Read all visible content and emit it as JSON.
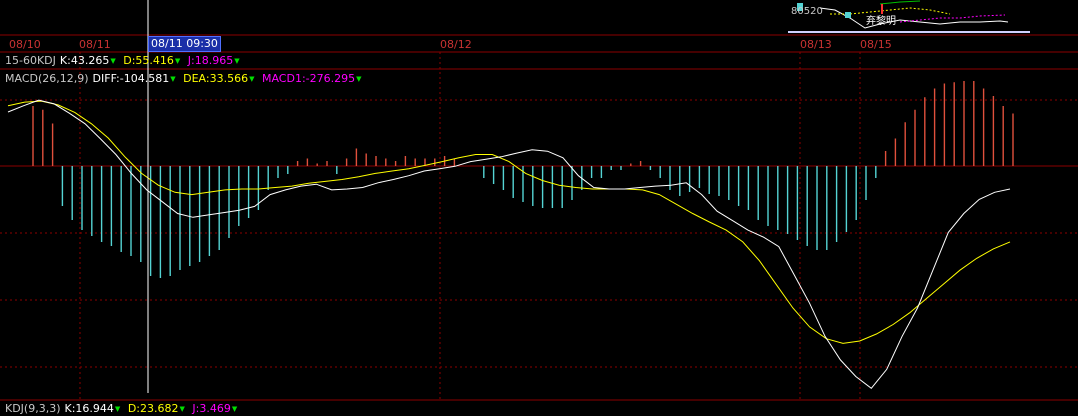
{
  "date_axis": {
    "labels": [
      "08/10",
      "08/11",
      "08/12",
      "08/13",
      "08/15"
    ],
    "cursor_label": "08/11 09:30"
  },
  "kdj_15_60": {
    "name": "15-60KDJ",
    "k": "K:43.265",
    "d": "D:55.416",
    "j": "J:18.965"
  },
  "macd": {
    "name": "MACD(26,12,9)",
    "diff": "DIFF:-104.581",
    "dea": "DEA:33.566",
    "macd1": "MACD1:-276.295"
  },
  "kdj_bottom": {
    "name": "KDJ(9,3,3)",
    "k": "K:16.944",
    "d": "D:23.682",
    "j": "J:3.469"
  },
  "mini_panel": {
    "value_text": "80520",
    "tag_text": "弃黎明"
  },
  "colors": {
    "background": "#000000",
    "grid": "#8b0000",
    "positive_bar": "#e0503c",
    "negative_bar": "#54d4d4",
    "diff_line": "#ffffff",
    "dea_line": "#ffff00",
    "k_color": "#ffffff",
    "d_color": "#ffff00",
    "j_color": "#ff00ff",
    "date_label": "#c83232"
  },
  "chart_data": {
    "type": "line",
    "title": "MACD(26,12,9)",
    "histogram": [
      48,
      45,
      34,
      -20,
      -27,
      -32,
      -35,
      -38,
      -40,
      -43,
      -45,
      -48,
      -55,
      -56,
      -55,
      -52,
      -50,
      -48,
      -45,
      -42,
      -36,
      -30,
      -26,
      -22,
      -12,
      -6,
      -4,
      4,
      6,
      2,
      4,
      -4,
      6,
      14,
      10,
      8,
      6,
      4,
      8,
      6,
      6,
      6,
      8,
      6,
      0,
      0,
      -6,
      -9,
      -12,
      -16,
      -18,
      -20,
      -21,
      -21,
      -21,
      -17,
      -12,
      -6,
      -6,
      -2,
      -2,
      2,
      4,
      -2,
      -6,
      -12,
      -15,
      -13,
      -11,
      -14,
      -15,
      -17,
      -20,
      -22,
      -27,
      -30,
      -32,
      -34,
      -37,
      -40,
      -42,
      -42,
      -38,
      -33,
      -27,
      -17,
      -6,
      12,
      22,
      35,
      45,
      55,
      62,
      66,
      67,
      68,
      68,
      62,
      56,
      48,
      42
    ],
    "diff": [
      75,
      88,
      100,
      92,
      72,
      50,
      18,
      -15,
      -55,
      -90,
      -115,
      -140,
      -148,
      -143,
      -138,
      -133,
      -125,
      -100,
      -90,
      -82,
      -78,
      -90,
      -88,
      -85,
      -75,
      -68,
      -60,
      -50,
      -45,
      -40,
      -30,
      -25,
      -20,
      -12,
      -5,
      -8,
      -22,
      -60,
      -85,
      -88,
      -88,
      -85,
      -82,
      -80,
      -75,
      -100,
      -135,
      -155,
      -175,
      -190,
      -210,
      -270,
      -330,
      -400,
      -450,
      -485,
      -510,
      -470,
      -400,
      -340,
      -260,
      -180,
      -140,
      -110,
      -95,
      -88
    ],
    "dea": [
      88,
      96,
      98,
      90,
      74,
      50,
      20,
      -20,
      -55,
      -80,
      -95,
      -100,
      -95,
      -90,
      -88,
      -88,
      -85,
      -82,
      -76,
      -72,
      -68,
      -62,
      -55,
      -50,
      -45,
      -38,
      -30,
      -22,
      -15,
      -15,
      -30,
      -55,
      -70,
      -80,
      -85,
      -88,
      -88,
      -88,
      -90,
      -100,
      -120,
      -140,
      -158,
      -175,
      -200,
      -240,
      -290,
      -340,
      -380,
      -405,
      -415,
      -410,
      -395,
      -375,
      -350,
      -320,
      -290,
      -260,
      -235,
      -215,
      -200
    ],
    "ylim": [
      -520,
      130
    ],
    "series": [
      {
        "name": "DIFF",
        "color": "#ffffff"
      },
      {
        "name": "DEA",
        "color": "#ffff00"
      },
      {
        "name": "MACD1",
        "color": "#e0503c"
      }
    ]
  }
}
